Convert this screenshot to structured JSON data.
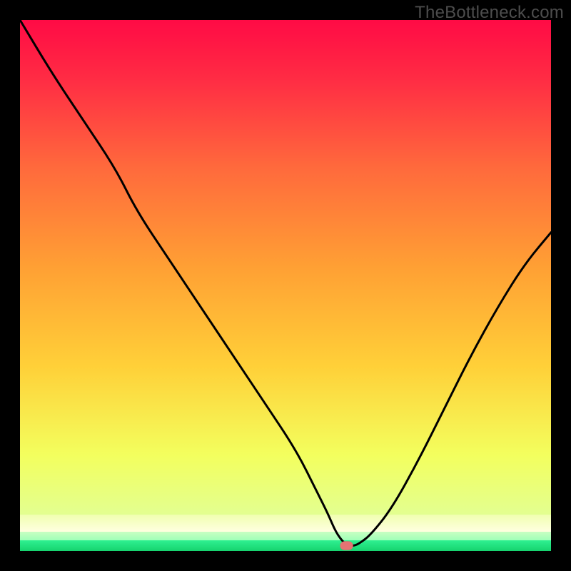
{
  "watermark": "TheBottleneck.com",
  "chart_data": {
    "type": "line",
    "title": "",
    "xlabel": "",
    "ylabel": "",
    "xlim": [
      0,
      100
    ],
    "ylim": [
      0,
      100
    ],
    "series": [
      {
        "name": "curve",
        "x": [
          0,
          6,
          12,
          18,
          22,
          28,
          34,
          40,
          46,
          52,
          56,
          58,
          59.5,
          61,
          62,
          63,
          64,
          66,
          70,
          75,
          80,
          85,
          90,
          95,
          100
        ],
        "values": [
          100,
          90,
          81,
          72,
          64,
          55,
          46,
          37,
          28,
          19,
          11,
          7,
          3.5,
          1.5,
          1,
          1,
          1.5,
          3,
          8,
          17,
          27,
          37,
          46,
          54,
          60
        ]
      }
    ],
    "marker": {
      "x": 61.5,
      "y": 1
    },
    "gradient_bands": [
      {
        "y_from": 100,
        "y_to": 7,
        "color_top": "#ff0b45",
        "color_bottom": "#cfff5a"
      },
      {
        "y_from": 7,
        "y_to": 3.7,
        "color_top": "#e5ffa0",
        "color_bottom": "#ffffd0"
      },
      {
        "y_from": 3.7,
        "y_to": 2.1,
        "color_top": "#a8ff9c",
        "color_bottom": "#9fffb4"
      },
      {
        "y_from": 2.1,
        "y_to": 0,
        "color_top": "#1fe27b",
        "color_bottom": "#16d36e"
      }
    ]
  }
}
